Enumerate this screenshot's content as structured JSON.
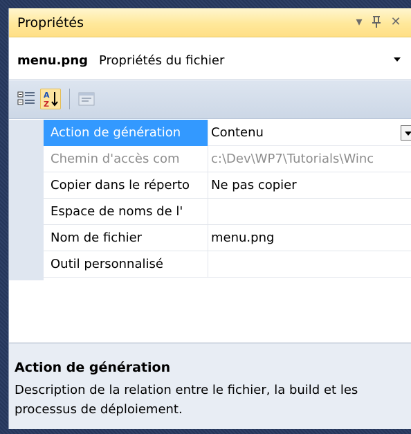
{
  "window": {
    "title": "Propriétés",
    "icons": [
      "dropdown-arrow-icon",
      "pin-icon",
      "close-icon"
    ]
  },
  "selector": {
    "object_name": "menu.png",
    "object_type": "Propriétés du fichier"
  },
  "toolbar": {
    "buttons": [
      "categorized-icon",
      "alphabetical-sort-icon",
      "property-pages-icon"
    ]
  },
  "properties": [
    {
      "name": "Action de génération",
      "value": "Contenu",
      "selected": true,
      "readonly": false,
      "has_dropdown": true
    },
    {
      "name": "Chemin d'accès com",
      "value": "c:\\Dev\\WP7\\Tutorials\\Winc",
      "selected": false,
      "readonly": true,
      "has_dropdown": false
    },
    {
      "name": "Copier dans le réperto",
      "value": "Ne pas copier",
      "selected": false,
      "readonly": false,
      "has_dropdown": false
    },
    {
      "name": "Espace de noms de l'",
      "value": "",
      "selected": false,
      "readonly": false,
      "has_dropdown": false
    },
    {
      "name": "Nom de fichier",
      "value": "menu.png",
      "selected": false,
      "readonly": false,
      "has_dropdown": false
    },
    {
      "name": "Outil personnalisé",
      "value": "",
      "selected": false,
      "readonly": false,
      "has_dropdown": false
    }
  ],
  "description": {
    "title": "Action de génération",
    "text": "Description de la relation entre le fichier, la build et les processus de déploiement."
  },
  "colors": {
    "title_bar": "#ffe89a",
    "selection": "#3399ff",
    "toolbar": "#ccd7e6",
    "description_bg": "#e8edf4"
  }
}
